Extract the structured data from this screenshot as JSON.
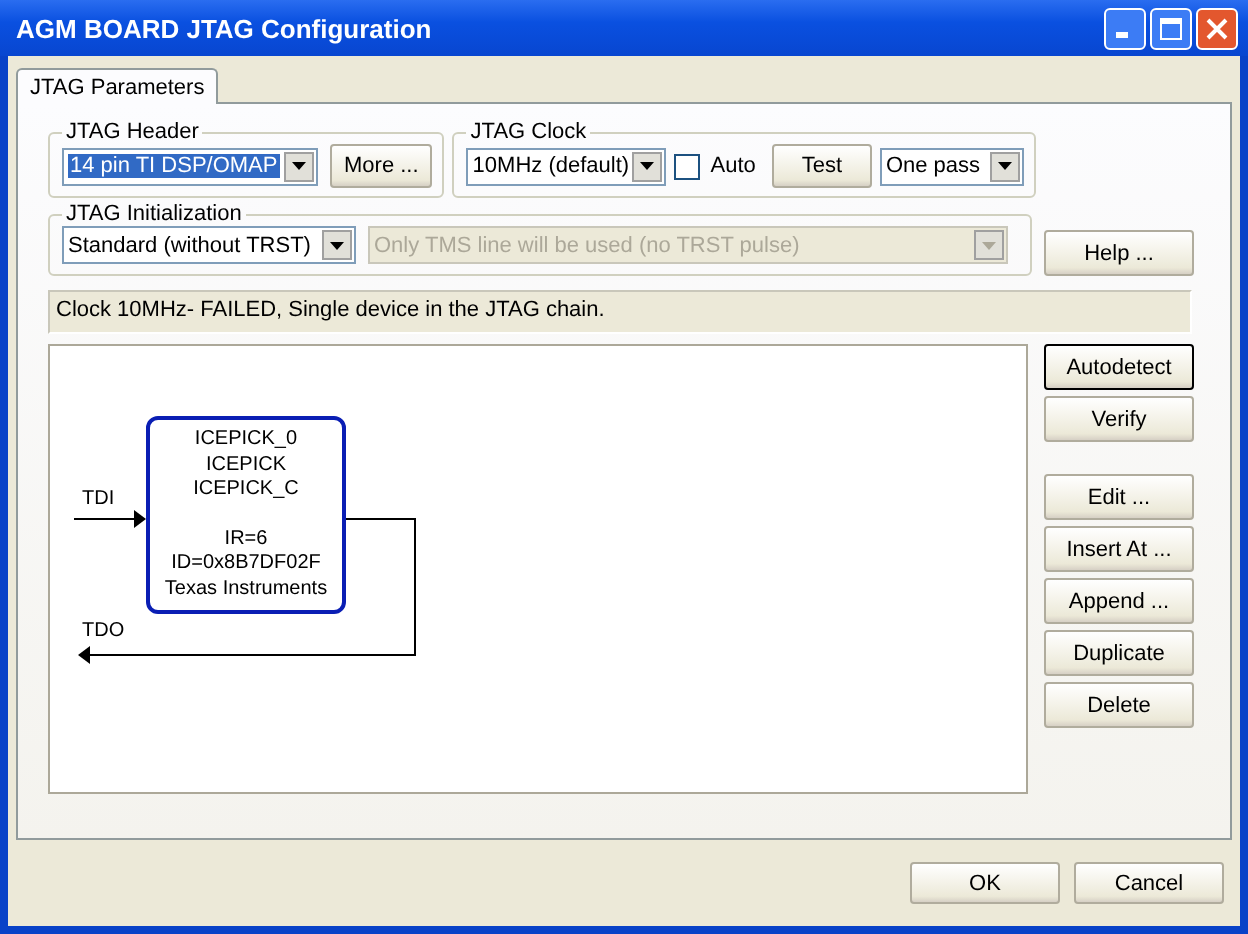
{
  "window": {
    "title": "AGM BOARD JTAG Configuration"
  },
  "tabs": [
    {
      "label": "JTAG Parameters",
      "selected": true
    }
  ],
  "jtag_header": {
    "label": "JTAG Header",
    "value": "14 pin TI DSP/OMAP",
    "more_button": "More ..."
  },
  "jtag_clock": {
    "label": "JTAG Clock",
    "value": "10MHz (default)",
    "auto": {
      "label": "Auto",
      "checked": false
    },
    "test_button": "Test",
    "mode": "One pass"
  },
  "jtag_initialization": {
    "label": "JTAG Initialization",
    "value": "Standard (without TRST)",
    "option": {
      "value": "Only TMS line will be used (no TRST pulse)",
      "disabled": true
    }
  },
  "help_button": "Help ...",
  "status": "Clock 10MHz- FAILED, Single device in the JTAG chain.",
  "chain": {
    "tdi": "TDI",
    "tdo": "TDO",
    "devices": [
      {
        "lines": [
          "ICEPICK_0",
          "ICEPICK",
          "ICEPICK_C"
        ],
        "details": [
          "IR=6",
          "ID=0x8B7DF02F",
          "Texas Instruments"
        ]
      }
    ]
  },
  "detect_buttons": [
    {
      "label": "Autodetect",
      "default": true
    },
    {
      "label": "Verify",
      "default": false
    }
  ],
  "edit_buttons": [
    "Edit ...",
    "Insert At ...",
    "Append ...",
    "Duplicate",
    "Delete"
  ],
  "footer_buttons": [
    "OK",
    "Cancel"
  ]
}
